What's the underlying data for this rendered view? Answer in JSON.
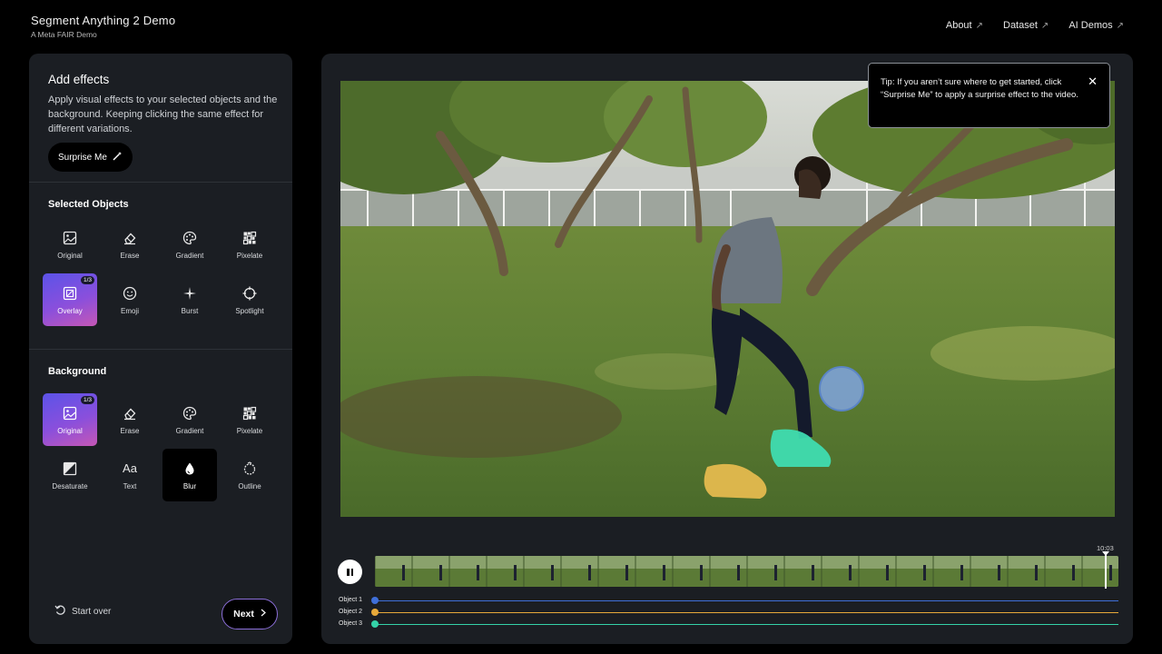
{
  "header": {
    "title": "Segment Anything 2 Demo",
    "subtitle": "A Meta FAIR Demo",
    "nav": [
      {
        "label": "About",
        "icon": "external-arrow-icon"
      },
      {
        "label": "Dataset",
        "icon": "external-arrow-icon"
      },
      {
        "label": "AI Demos",
        "icon": "external-arrow-icon"
      }
    ]
  },
  "panel": {
    "title": "Add effects",
    "description": "Apply visual effects to your selected objects and the background. Keeping clicking the same effect for different variations.",
    "surprise_label": "Surprise Me",
    "selected_section": "Selected Objects",
    "selected_effects": [
      {
        "label": "Original",
        "icon": "image-icon"
      },
      {
        "label": "Erase",
        "icon": "eraser-icon"
      },
      {
        "label": "Gradient",
        "icon": "palette-icon"
      },
      {
        "label": "Pixelate",
        "icon": "pixelate-icon"
      },
      {
        "label": "Overlay",
        "icon": "overlay-icon",
        "badge": "1/3"
      },
      {
        "label": "Emoji",
        "icon": "emoji-icon"
      },
      {
        "label": "Burst",
        "icon": "burst-icon"
      },
      {
        "label": "Spotlight",
        "icon": "spotlight-icon"
      }
    ],
    "background_section": "Background",
    "background_effects": [
      {
        "label": "Original",
        "icon": "image-icon",
        "badge": "1/3"
      },
      {
        "label": "Erase",
        "icon": "eraser-icon"
      },
      {
        "label": "Gradient",
        "icon": "palette-icon"
      },
      {
        "label": "Pixelate",
        "icon": "pixelate-icon"
      },
      {
        "label": "Desaturate",
        "icon": "desaturate-icon"
      },
      {
        "label": "Text",
        "icon": "text-icon",
        "glyph": "Aa"
      },
      {
        "label": "Blur",
        "icon": "droplet-icon"
      },
      {
        "label": "Outline",
        "icon": "outline-icon"
      }
    ],
    "start_over_label": "Start over",
    "next_label": "Next"
  },
  "player": {
    "tip": "Tip: If you aren’t sure where to get started, click “Surprise Me” to apply a surprise effect to the video.",
    "time": "10:03",
    "tracks": [
      {
        "label": "Object 1",
        "color": "#3f6fd8"
      },
      {
        "label": "Object 2",
        "color": "#e8a93a"
      },
      {
        "label": "Object 3",
        "color": "#34d3a8"
      }
    ]
  },
  "colors": {
    "accent_gradient_start": "#5b53e8",
    "accent_gradient_end": "#c657b5",
    "panel_bg": "#1b1e23"
  }
}
